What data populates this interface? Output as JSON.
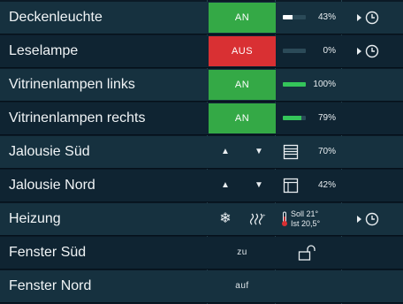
{
  "rows": [
    {
      "name": "Deckenleuchte",
      "button": "AN",
      "level": "43%",
      "fraction": 0.43,
      "fill_color": "#ffffff"
    },
    {
      "name": "Leselampe",
      "button": "AUS",
      "level": "0%",
      "fraction": 0.0,
      "fill_color": "#ffffff"
    },
    {
      "name": "Vitrinenlampen links",
      "button": "AN",
      "level": "100%",
      "fraction": 1.0,
      "fill_color": "#34c55a"
    },
    {
      "name": "Vitrinenlampen rechts",
      "button": "AN",
      "level": "79%",
      "fraction": 0.79,
      "fill_color": "#34c55a"
    },
    {
      "name": "Jalousie Süd",
      "level": "70%"
    },
    {
      "name": "Jalousie Nord",
      "level": "42%"
    },
    {
      "name": "Heizung",
      "soll": "Soll 21°",
      "ist": "Ist  20,5°"
    },
    {
      "name": "Fenster Süd",
      "button": "zu"
    },
    {
      "name": "Fenster Nord",
      "button": "auf"
    }
  ],
  "colors": {
    "on": "#34a946",
    "off": "#d93033",
    "row_alt": "#16313f",
    "row_plain": "#0f2432"
  },
  "icons": [
    "play-icon",
    "clock-icon",
    "arrow-up-icon",
    "arrow-down-icon",
    "blind-icon",
    "snowflake-icon",
    "heat-waves-icon",
    "thermometer-icon",
    "open-lock-icon"
  ]
}
